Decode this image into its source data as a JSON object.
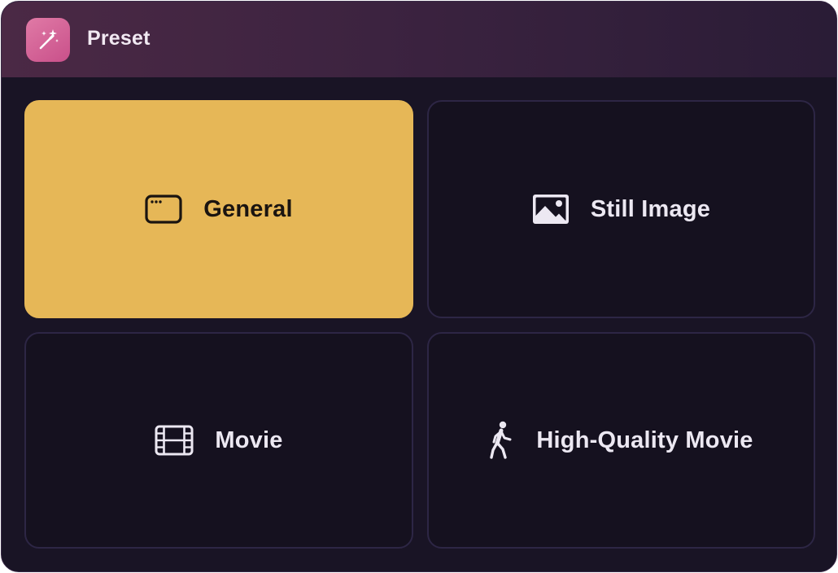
{
  "header": {
    "title": "Preset",
    "icon": "magic-wand-icon",
    "icon_gradient": [
      "#e07aa6",
      "#c9508a"
    ]
  },
  "colors": {
    "window_bg": "#191425",
    "tile_bg": "#15111f",
    "tile_border": "#2d2645",
    "selected_bg": "#e6b757",
    "selected_text": "#1a1410",
    "text": "#ece8f2"
  },
  "presets": [
    {
      "label": "General",
      "icon": "browser-window-icon",
      "selected": true
    },
    {
      "label": "Still Image",
      "icon": "photo-icon",
      "selected": false
    },
    {
      "label": "Movie",
      "icon": "film-icon",
      "selected": false
    },
    {
      "label": "High-Quality Movie",
      "icon": "walking-figure-icon",
      "selected": false
    }
  ]
}
